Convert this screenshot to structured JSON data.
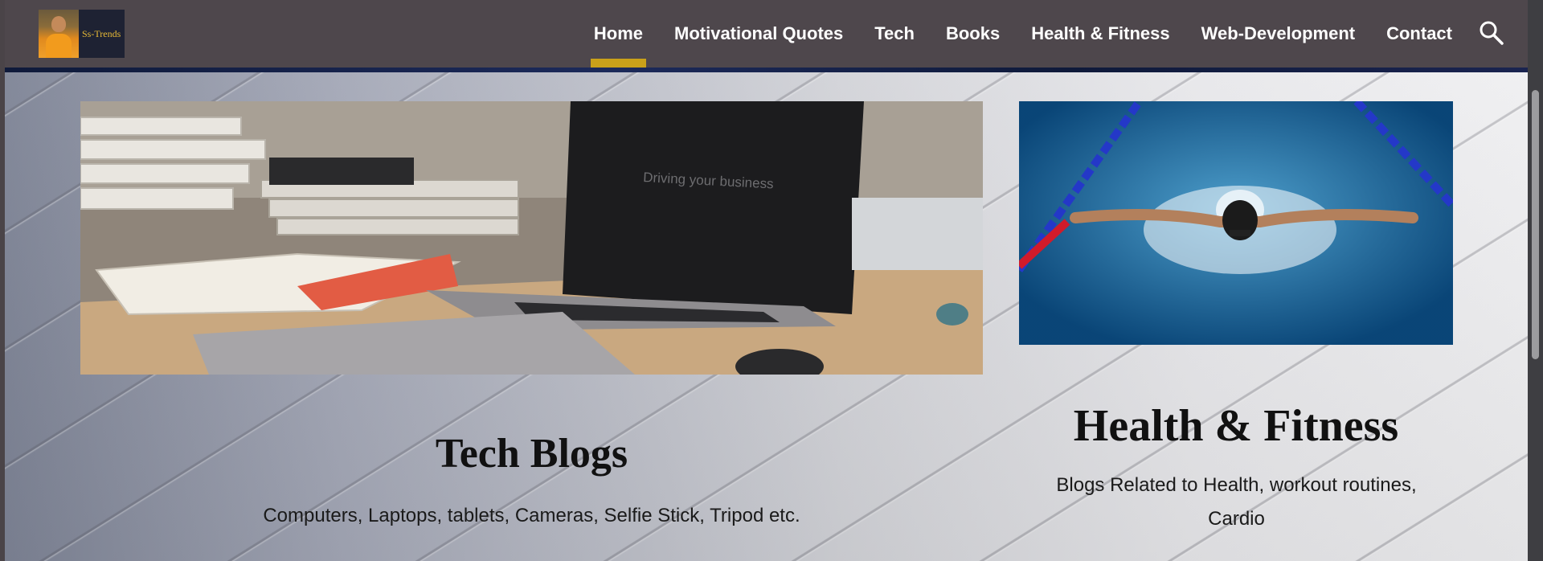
{
  "site": {
    "logo_text": "Ss-Trends"
  },
  "nav": {
    "items": [
      {
        "label": "Home",
        "active": true
      },
      {
        "label": "Motivational Quotes",
        "active": false
      },
      {
        "label": "Tech",
        "active": false
      },
      {
        "label": "Books",
        "active": false
      },
      {
        "label": "Health & Fitness",
        "active": false
      },
      {
        "label": "Web-Development",
        "active": false
      },
      {
        "label": "Contact",
        "active": false
      }
    ],
    "search_icon": "search-icon",
    "accent_color": "#c9a11a"
  },
  "cards": {
    "tech": {
      "image": "laptop-desk-photo",
      "image_caption": "Driving your business",
      "title": "Tech Blogs",
      "description": "Computers, Laptops, tablets, Cameras, Selfie Stick, Tripod etc."
    },
    "fitness": {
      "image": "swimmer-pool-photo",
      "title": "Health & Fitness",
      "description": "Blogs Related to Health, workout routines, Cardio"
    }
  }
}
